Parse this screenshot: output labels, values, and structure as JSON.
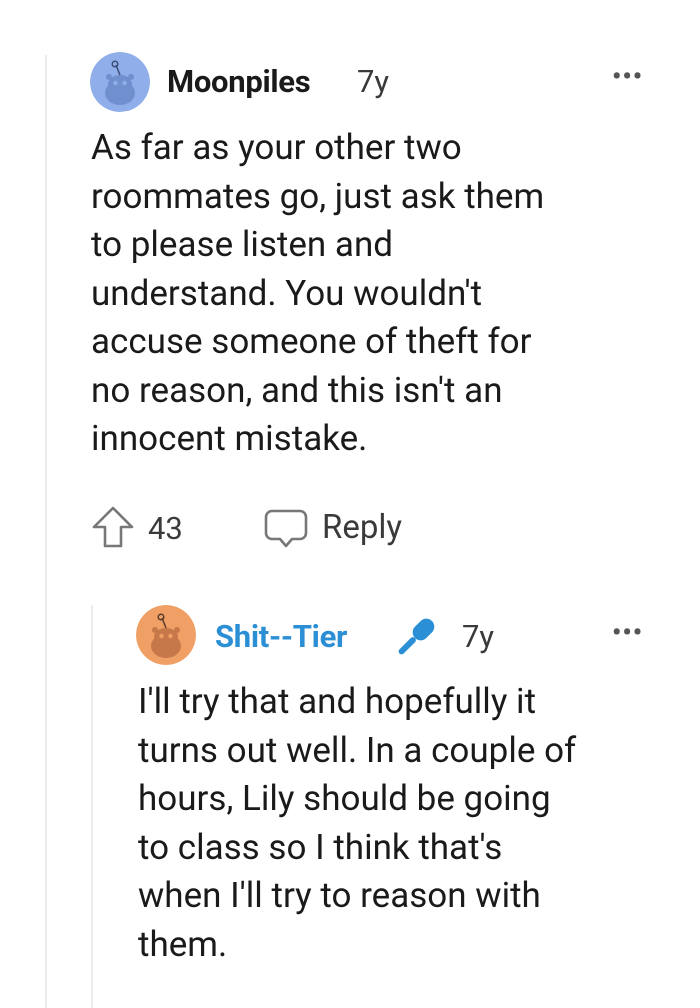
{
  "comments": [
    {
      "username": "Moonpiles",
      "age": "7y",
      "avatar_color": "#8faeea",
      "body": "As far as your other two\nroommates go, just ask them\nto please listen and\nunderstand. You wouldn't\naccuse someone of theft for\nno reason, and this isn't an\ninnocent mistake.",
      "votes": "43",
      "reply_label": "Reply",
      "more_label": "•••"
    },
    {
      "username": "Shit--Tier",
      "age": "7y",
      "avatar_color": "#f0a064",
      "badge_icon": "microphone-icon",
      "username_color": "#2b8fd6",
      "body": "I'll try that and hopefully it\nturns out well. In a couple of\nhours, Lily should be going\nto class so I think that's\nwhen I'll try to reason with\nthem.",
      "more_label": "•••"
    }
  ]
}
